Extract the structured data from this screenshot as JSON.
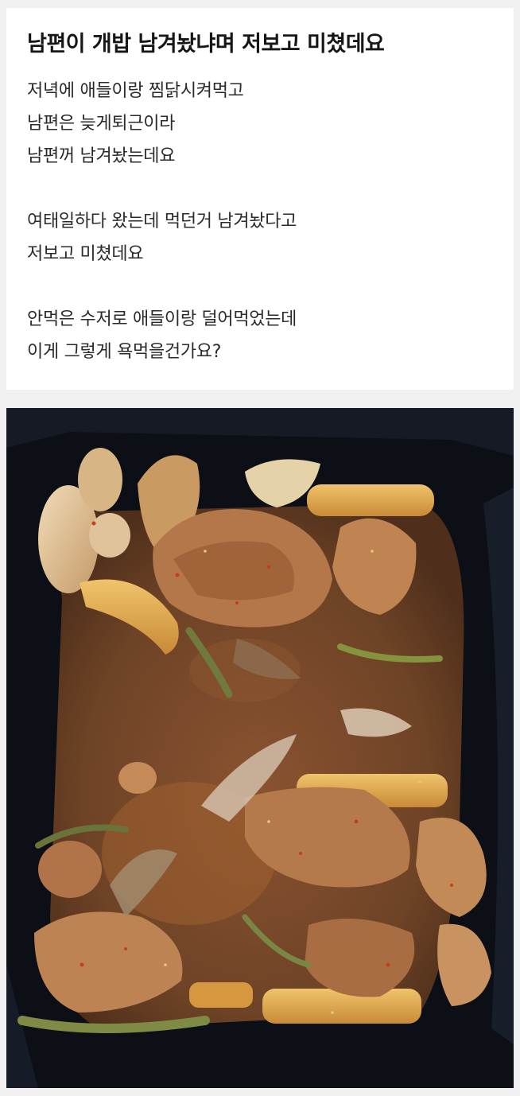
{
  "post": {
    "title": "남편이 개밥 남겨놨냐며 저보고 미쳤데요",
    "lines": [
      "저녁에 애들이랑 찜닭시켜먹고",
      "남편은 늦게퇴근이라",
      "남편꺼 남겨놨는데요",
      "",
      "여태일하다 왔는데 먹던거 남겨놨다고",
      "저보고 미쳤데요",
      "",
      "안먹은 수저로 애들이랑 덜어먹었는데",
      "이게 그렇게 욕먹을건가요?"
    ]
  },
  "photo": {
    "subject": "leftover-braised-chicken-in-black-container",
    "colors": {
      "container": "#0c0f16",
      "sauce": "#6e4326",
      "chicken": "#b4774a",
      "rice_cake": "#d79c45",
      "onion": "#d9b98d",
      "scallion": "#6f7a3c"
    }
  }
}
